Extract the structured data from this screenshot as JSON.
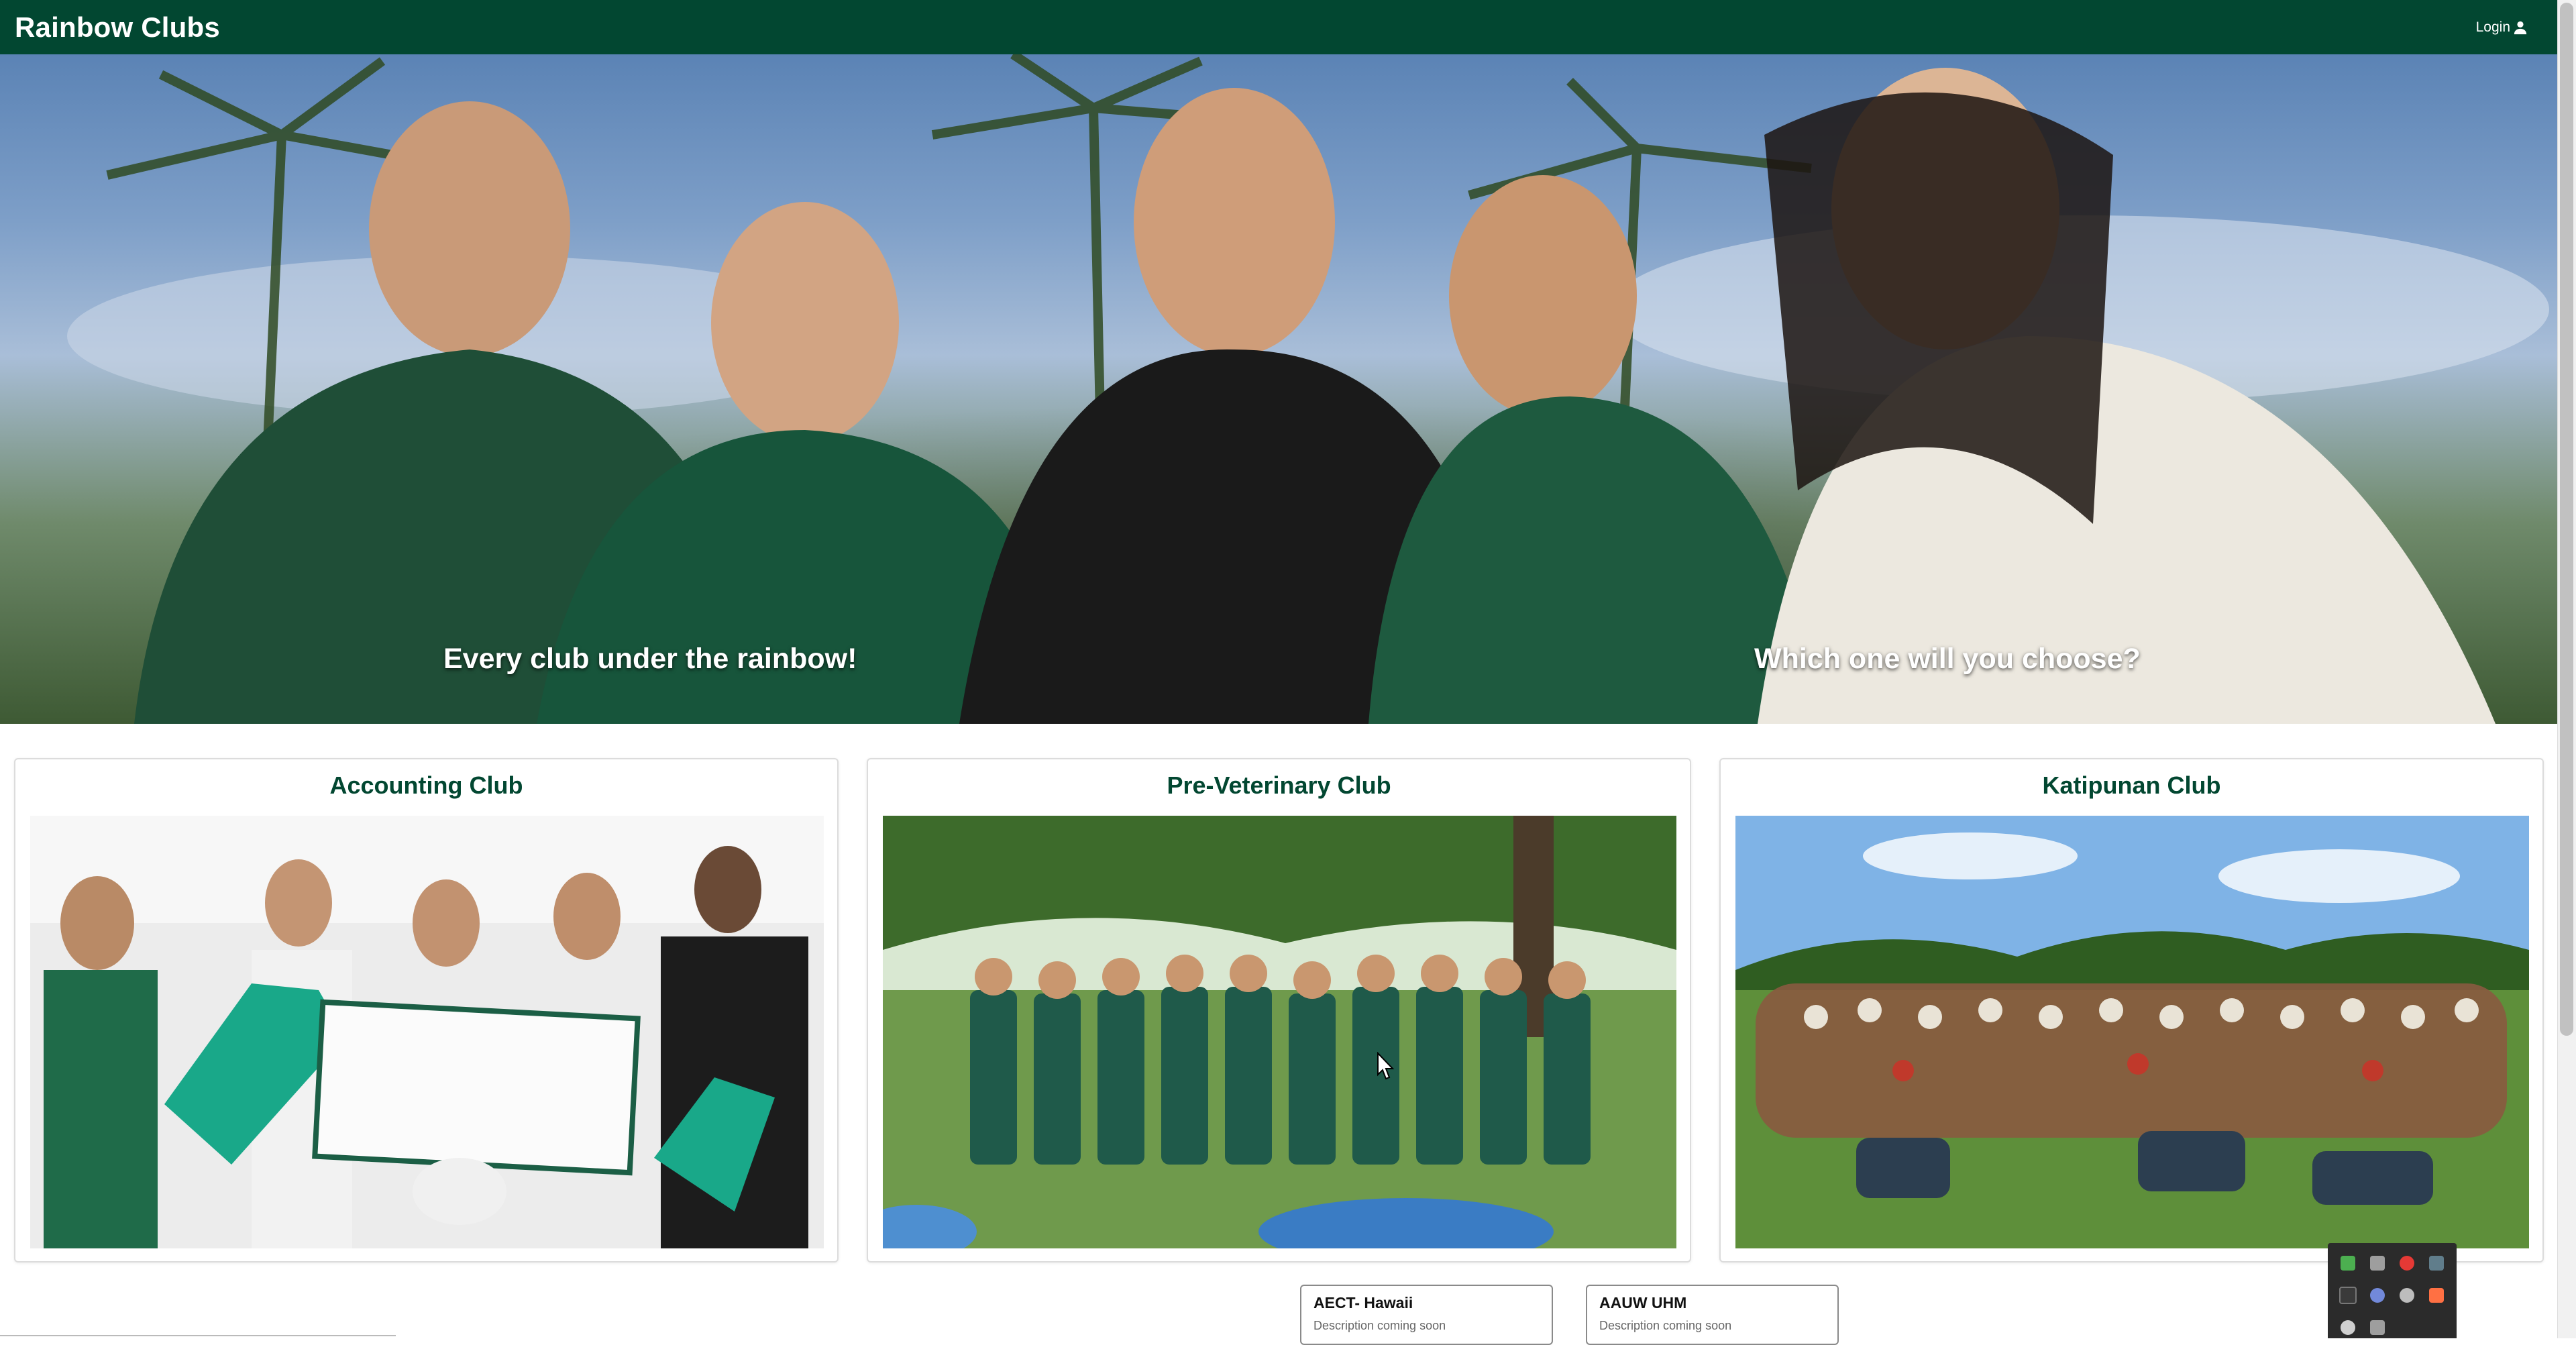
{
  "navbar": {
    "brand": "Rainbow Clubs",
    "login_label": "Login",
    "login_icon": "user-icon",
    "background_color": "#024731"
  },
  "hero": {
    "caption_left": "Every club under the rainbow!",
    "caption_right": "Which one will you choose?"
  },
  "clubs": [
    {
      "title": "Accounting Club",
      "image": "accounting-club-photo"
    },
    {
      "title": "Pre-Veterinary Club",
      "image": "pre-veterinary-club-photo"
    },
    {
      "title": "Katipunan Club",
      "image": "katipunan-club-photo"
    }
  ],
  "mini_clubs": [
    {
      "name": "AECT- Hawaii",
      "description": "Description coming soon"
    },
    {
      "name": "AAUW UHM",
      "description": "Description coming soon"
    }
  ],
  "colors": {
    "accent_green": "#024731",
    "card_border": "#dcdcdc"
  }
}
